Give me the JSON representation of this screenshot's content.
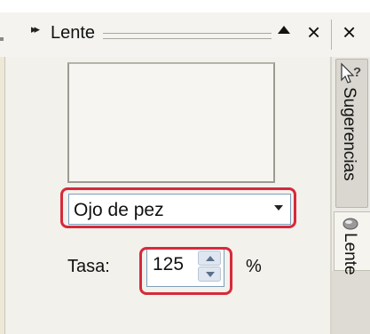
{
  "panel": {
    "title": "Lente",
    "collapse_icon": "double-chevron-right-icon",
    "menu_icon": "triangle-up-icon",
    "close_icon": "close-icon"
  },
  "lens": {
    "type_selected": "Ojo de pez",
    "rate_label": "Tasa:",
    "rate_value": "125",
    "rate_unit": "%"
  },
  "side_tabs": [
    {
      "label": "Sugerencias",
      "icon": "help-cursor-icon"
    },
    {
      "label": "Lente",
      "icon": "lens-icon"
    }
  ],
  "highlight_color": "#d62a3a"
}
